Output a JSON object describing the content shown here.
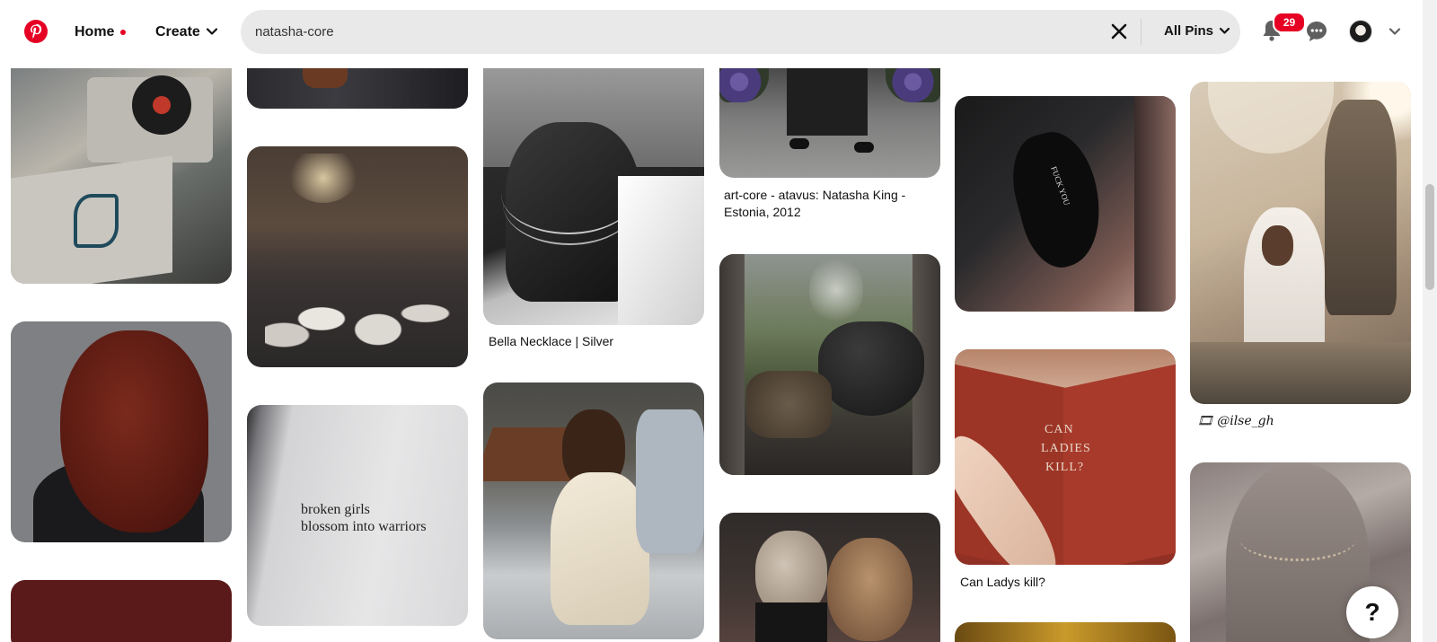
{
  "header": {
    "home_label": "Home",
    "create_label": "Create",
    "search": {
      "value": "natasha-core",
      "placeholder": "Search"
    },
    "filter_label": "All Pins",
    "notification_count": "29"
  },
  "pins": [
    {
      "caption": ""
    },
    {
      "caption": "Bella Necklace | Silver"
    },
    {
      "caption": "art-core - atavus: Natasha King - Estonia, 2012"
    },
    {
      "caption": "Can Ladys kill?"
    },
    {
      "caption": "🎞 @ilse_gh"
    }
  ],
  "pin_texts": {
    "book_line1": "broken girls",
    "book_line2": "blossom into warriors",
    "red_book_1": "CAN",
    "red_book_2": "LADIES",
    "red_book_3": "KILL?",
    "heel_text": "FUCK YOU"
  },
  "help_label": "?",
  "colors": {
    "brand": "#e60023",
    "search_bg": "#e9e9e9"
  }
}
